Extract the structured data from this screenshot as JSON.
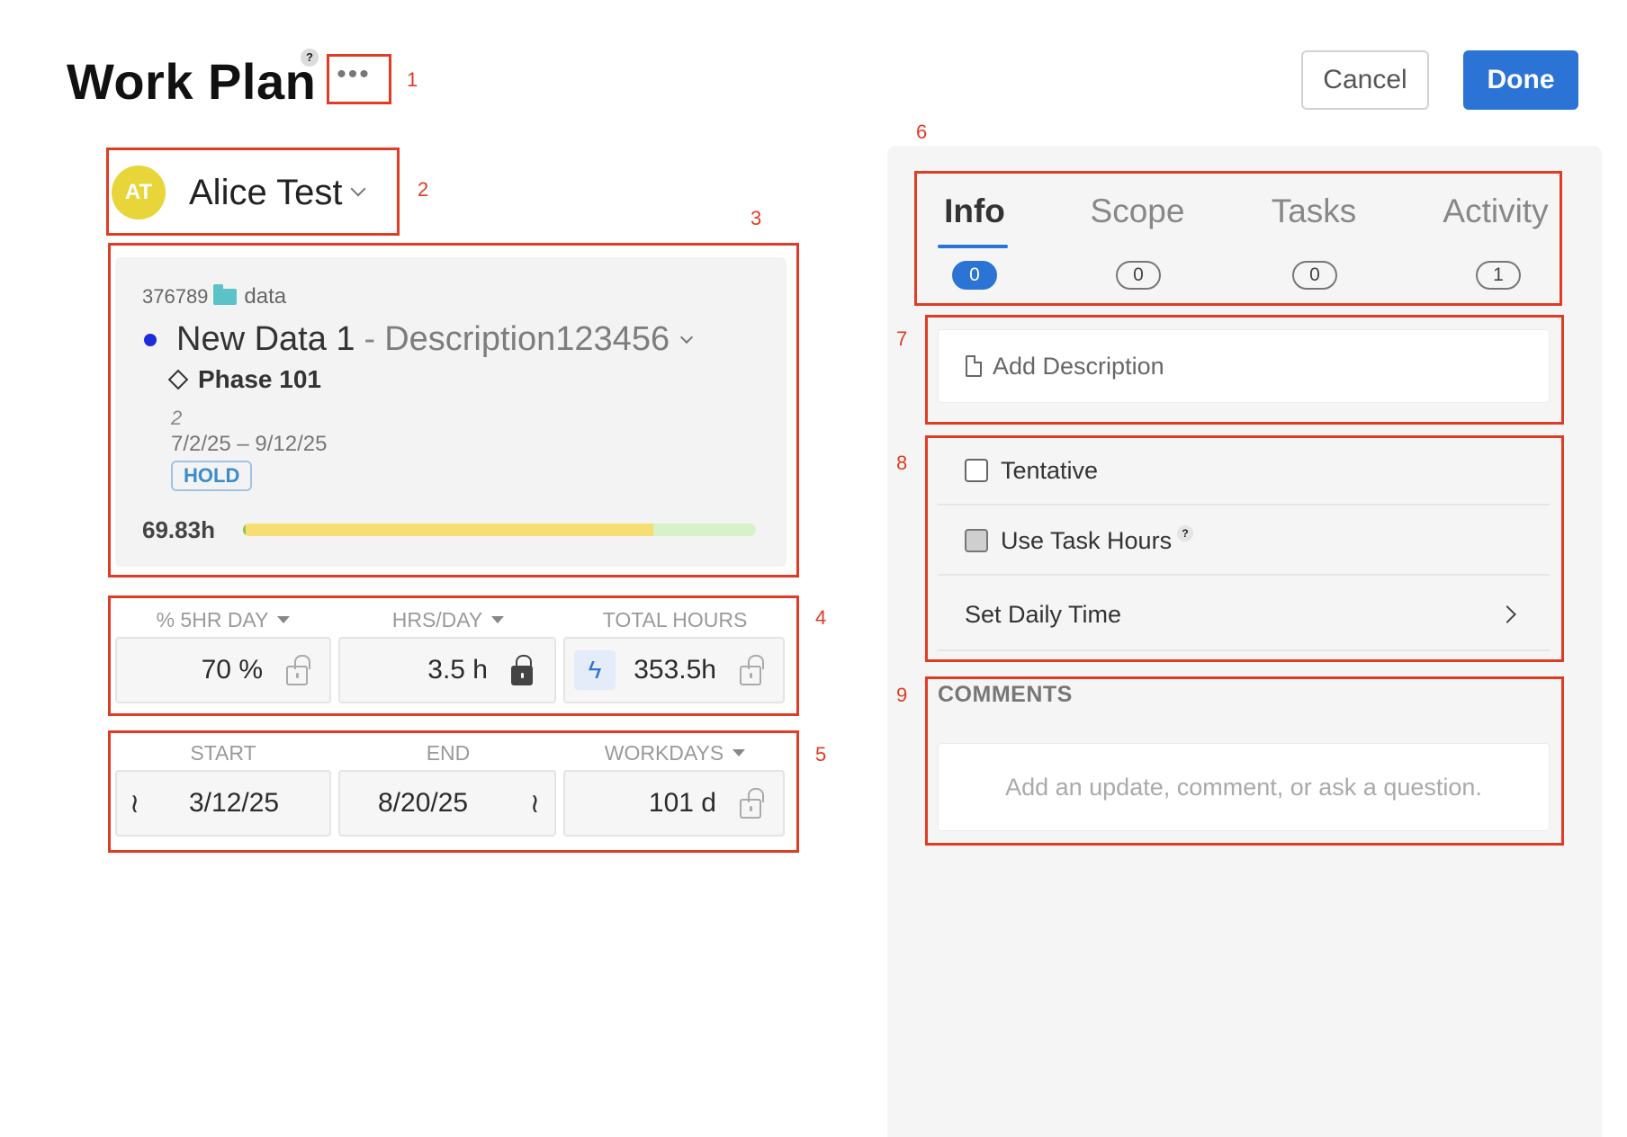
{
  "header": {
    "title": "Work Plan",
    "help": "?",
    "more_icon": "•••",
    "cancel_label": "Cancel",
    "done_label": "Done"
  },
  "member": {
    "initials": "AT",
    "name": "Alice Test",
    "avatar_color": "#e8d53a"
  },
  "project": {
    "id": "376789",
    "folder": "data",
    "name": "New Data 1",
    "separator": "-",
    "description": "Description123456",
    "phase": "Phase 101",
    "phase_number": "2",
    "phase_dates": "7/2/25 – 9/12/25",
    "status": "HOLD",
    "hours": "69.83h",
    "progress_fraction": 0.8
  },
  "allocation": {
    "headers": [
      "% 5HR DAY",
      "HRS/DAY",
      "TOTAL HOURS"
    ],
    "percent": "70 %",
    "hrs_per_day": "3.5 h",
    "total_hours": "353.5h"
  },
  "schedule": {
    "headers": [
      "START",
      "END",
      "WORKDAYS"
    ],
    "start": "3/12/25",
    "end": "8/20/25",
    "workdays": "101 d"
  },
  "tabs": [
    {
      "label": "Info",
      "count": "0",
      "active": true
    },
    {
      "label": "Scope",
      "count": "0",
      "active": false
    },
    {
      "label": "Tasks",
      "count": "0",
      "active": false
    },
    {
      "label": "Activity",
      "count": "1",
      "active": false
    }
  ],
  "info": {
    "add_description": "Add Description",
    "tentative_label": "Tentative",
    "use_task_hours_label": "Use Task Hours",
    "help": "?",
    "set_daily_time_label": "Set Daily Time"
  },
  "comments": {
    "title": "COMMENTS",
    "placeholder": "Add an update, comment, or ask a question."
  },
  "annotations": [
    "1",
    "2",
    "3",
    "4",
    "5",
    "6",
    "7",
    "8",
    "9"
  ],
  "colors": {
    "accent": "#2b74d6",
    "annotation": "#e03b24",
    "project_dot": "#1f2bd8"
  }
}
